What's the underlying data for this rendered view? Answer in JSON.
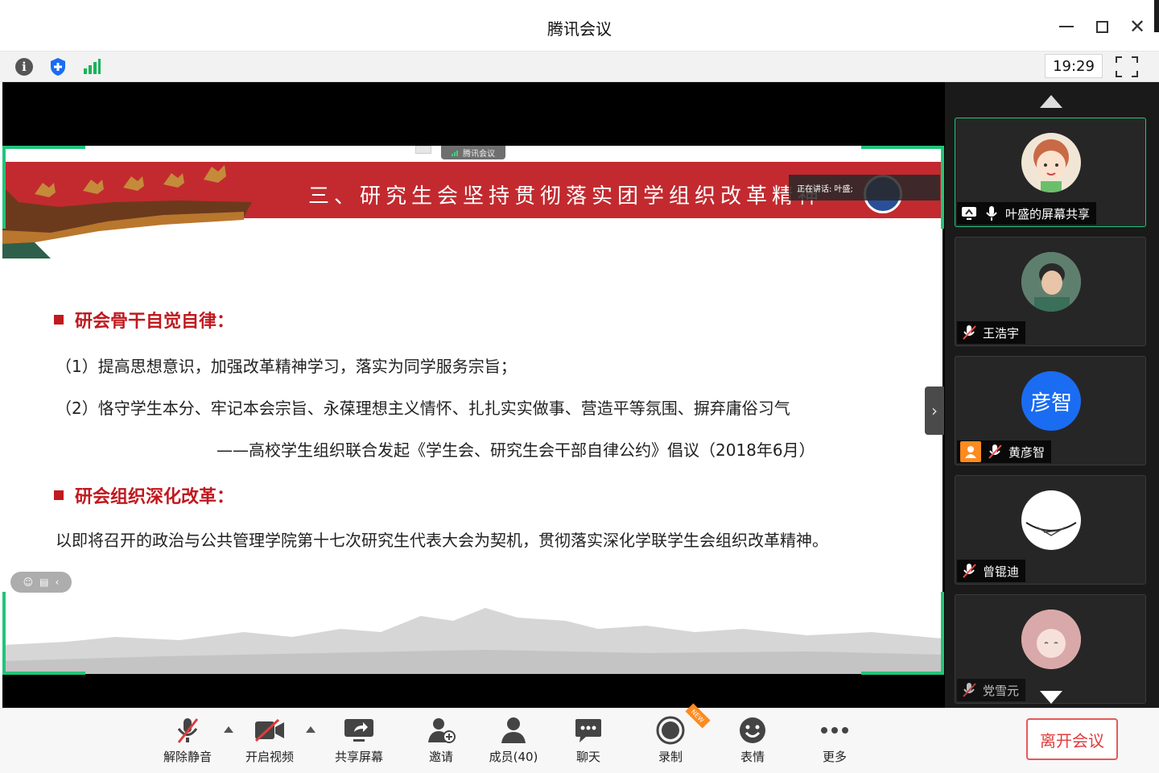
{
  "window": {
    "title": "腾讯会议",
    "controls": [
      "minimize-icon",
      "maximize-icon",
      "close-icon"
    ]
  },
  "infobar": {
    "icons": [
      "info-icon",
      "shield-icon",
      "signal-icon"
    ],
    "time": "19:29"
  },
  "share": {
    "tab_label": "腾讯会议",
    "speaking_label": "正在讲话: 叶盛;"
  },
  "slide": {
    "title": "三、研究生会坚持贯彻落实团学组织改革精神",
    "heading1": "研会骨干自觉自律：",
    "line1": "（1）提高思想意识，加强改革精神学习，落实为同学服务宗旨；",
    "line2": "（2）恪守学生本分、牢记本会宗旨、永葆理想主义情怀、扎扎实实做事、营造平等氛围、摒弃庸俗习气",
    "line3": "——高校学生组织联合发起《学生会、研究生会干部自律公约》倡议（2018年6月）",
    "heading2": "研会组织深化改革：",
    "line4": "以即将召开的政治与公共管理学院第十七次研究生代表大会为契机，贯彻落实深化学联学生会组织改革精神。"
  },
  "participants": [
    {
      "name": "叶盛的屏幕共享",
      "avatar": "cartoon-avatar",
      "muted": false,
      "sharing": true
    },
    {
      "name": "王浩宇",
      "avatar": "photo-avatar",
      "muted": true
    },
    {
      "name": "黄彦智",
      "avatar_text": "彦智",
      "avatar_color": "#1a6cf2",
      "muted": true,
      "host_badge": true
    },
    {
      "name": "曾锟迪",
      "avatar": "sketch-avatar",
      "muted": true
    },
    {
      "name": "党雪元",
      "avatar": "anime-avatar",
      "muted": true
    }
  ],
  "toolbar": {
    "unmute": "解除静音",
    "start_video": "开启视频",
    "share_screen": "共享屏幕",
    "invite": "邀请",
    "members": "成员(40)",
    "chat": "聊天",
    "record": "录制",
    "record_badge": "NEW",
    "reactions": "表情",
    "more": "更多",
    "leave": "离开会议"
  },
  "colors": {
    "accent_green": "#22c47a",
    "leave_red": "#e03c3c",
    "banner_red": "#c22a2f",
    "avatar_blue": "#1a6cf2"
  }
}
